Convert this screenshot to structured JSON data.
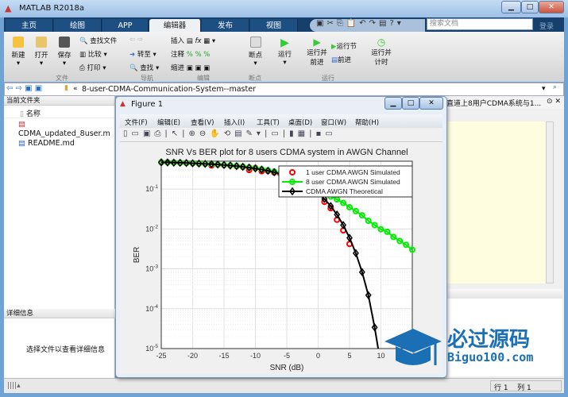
{
  "app": {
    "title": "MATLAB R2018a",
    "login": "登录",
    "search_placeholder": "搜索文档"
  },
  "tabs": [
    {
      "label": "主页"
    },
    {
      "label": "绘图"
    },
    {
      "label": "APP"
    },
    {
      "label": "编辑器",
      "active": true
    },
    {
      "label": "发布"
    },
    {
      "label": "视图"
    }
  ],
  "ribbon": {
    "file": {
      "group": "文件",
      "new": "新建",
      "open": "打开",
      "save": "保存",
      "find_files": "查找文件",
      "compare": "比较",
      "print": "打印"
    },
    "nav": {
      "group": "导航",
      "goto": "转至",
      "find": "查找"
    },
    "edit": {
      "group": "编辑",
      "insert": "插入",
      "comment": "注释",
      "indent": "缩进"
    },
    "breakpoints": {
      "group": "断点",
      "label": "断点"
    },
    "run": {
      "group": "运行",
      "run": "运行",
      "run_advance": "运行并前进",
      "run_section": "运行节",
      "advance": "前进",
      "run_time": "运行并计时"
    }
  },
  "address": {
    "path": "8-user-CDMA-Communication-System--master"
  },
  "current_folder": {
    "title": "当前文件夹",
    "column": "名称",
    "files": [
      "CDMA_updated_8user.m",
      "README.md"
    ]
  },
  "details": {
    "title": "详细信息",
    "empty_text": "选择文件以查看详细信息"
  },
  "editor": {
    "tab_title": "直道上8用户CDMA系统与1..."
  },
  "status": {
    "row_label": "行",
    "row": "1",
    "col_label": "列",
    "col": "1"
  },
  "figure": {
    "title": "Figure 1",
    "menu": [
      "文件(F)",
      "编辑(E)",
      "查看(V)",
      "插入(I)",
      "工具(T)",
      "桌面(D)",
      "窗口(W)",
      "帮助(H)"
    ]
  },
  "watermark": {
    "cn": "必过源码",
    "url": "Biguo100.com"
  },
  "chart_data": {
    "type": "line",
    "title": "SNR Vs BER plot for 8 users CDMA system in AWGN Channel",
    "xlabel": "SNR (dB)",
    "ylabel": "BER",
    "xlim": [
      -25,
      15
    ],
    "ylim": [
      1e-05,
      0.5
    ],
    "yscale": "log",
    "grid": true,
    "legend": "top-right",
    "xticks": [
      -25,
      -20,
      -15,
      -10,
      -5,
      0,
      5,
      10,
      15
    ],
    "yticks": [
      "10^-5",
      "10^-4",
      "10^-3",
      "10^-2",
      "10^-1"
    ],
    "series": [
      {
        "name": "1 user CDMA AWGN Simulated",
        "color": "#ff0000",
        "marker": "circle",
        "line": false,
        "x": [
          -25,
          -24,
          -23,
          -22,
          -21,
          -20,
          -19,
          -18,
          -17,
          -16,
          -15,
          -14,
          -13,
          -12,
          -11,
          -10,
          -9,
          -8,
          -7,
          -6,
          -5,
          -4,
          -3,
          -2,
          -1,
          0,
          1,
          2,
          3,
          4,
          5
        ],
        "y": [
          0.468,
          0.466,
          0.462,
          0.455,
          0.449,
          0.443,
          0.436,
          0.43,
          0.39,
          0.41,
          0.4,
          0.39,
          0.375,
          0.36,
          0.3,
          0.34,
          0.28,
          0.285,
          0.26,
          0.24,
          0.215,
          0.185,
          0.16,
          0.13,
          0.105,
          0.078,
          0.048,
          0.033,
          0.017,
          0.0092,
          0.0042
        ]
      },
      {
        "name": "8 user CDMA AWGN Simulated",
        "color": "#00ee00",
        "marker": "circle",
        "line": true,
        "x": [
          -25,
          -24,
          -23,
          -22,
          -21,
          -20,
          -19,
          -18,
          -17,
          -16,
          -15,
          -14,
          -13,
          -12,
          -11,
          -10,
          -9,
          -8,
          -7,
          -6,
          -5,
          -4,
          -3,
          -2,
          -1,
          0,
          1,
          2,
          3,
          4,
          5,
          6,
          7,
          8,
          9,
          10,
          11,
          12,
          13,
          14,
          15
        ],
        "y": [
          0.47,
          0.466,
          0.462,
          0.456,
          0.451,
          0.445,
          0.438,
          0.43,
          0.422,
          0.413,
          0.403,
          0.392,
          0.38,
          0.366,
          0.35,
          0.333,
          0.315,
          0.295,
          0.275,
          0.25,
          0.225,
          0.2,
          0.175,
          0.15,
          0.125,
          0.1,
          0.08,
          0.065,
          0.055,
          0.045,
          0.035,
          0.028,
          0.022,
          0.016,
          0.0125,
          0.0098,
          0.0085,
          0.0063,
          0.005,
          0.004,
          0.003
        ]
      },
      {
        "name": "CDMA AWGN Theoretical",
        "color": "#000000",
        "marker": "diamond",
        "line": true,
        "x": [
          -25,
          -24,
          -23,
          -22,
          -21,
          -20,
          -19,
          -18,
          -17,
          -16,
          -15,
          -14,
          -13,
          -12,
          -11,
          -10,
          -9,
          -8,
          -7,
          -6,
          -5,
          -4,
          -3,
          -2,
          -1,
          0,
          1,
          2,
          3,
          4,
          5,
          6,
          7,
          8,
          9,
          10
        ],
        "y": [
          0.468,
          0.464,
          0.46,
          0.455,
          0.45,
          0.444,
          0.437,
          0.429,
          0.421,
          0.411,
          0.401,
          0.389,
          0.376,
          0.361,
          0.345,
          0.327,
          0.308,
          0.287,
          0.264,
          0.239,
          0.213,
          0.186,
          0.158,
          0.131,
          0.104,
          0.0786,
          0.0563,
          0.0375,
          0.0229,
          0.0125,
          0.00597,
          0.00247,
          0.000827,
          0.000218,
          3.4e-05,
          3.87e-06
        ]
      }
    ]
  }
}
